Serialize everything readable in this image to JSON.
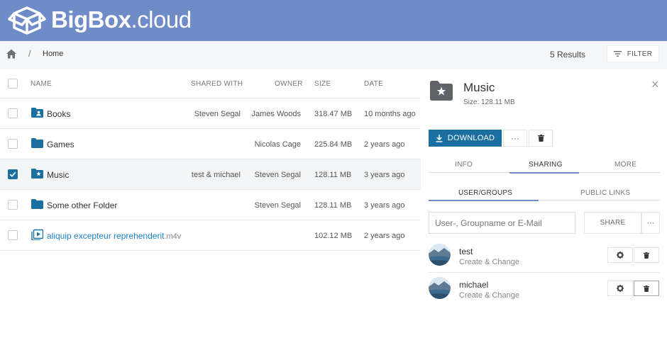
{
  "app": {
    "logo_bold": "BigBox",
    "logo_light": ".cloud"
  },
  "toolbar": {
    "breadcrumb_separator": "/",
    "breadcrumb": "Home",
    "results": "5 Results",
    "filter_label": "FILTER"
  },
  "list": {
    "columns": {
      "name": "NAME",
      "shared_with": "SHARED WITH",
      "owner": "OWNER",
      "size": "SIZE",
      "date": "DATE"
    },
    "rows": [
      {
        "name": "Books",
        "shared_with": "Steven Segal",
        "owner": "James Woods",
        "size": "318.47 MB",
        "date": "10 months ago",
        "icon": "shared-folder-icon",
        "checked": false
      },
      {
        "name": "Games",
        "shared_with": "",
        "owner": "Nicolas Cage",
        "size": "225.84 MB",
        "date": "2 years ago",
        "icon": "folder-icon",
        "checked": false
      },
      {
        "name": "Music",
        "shared_with": "test & michael",
        "owner": "Steven Segal",
        "size": "128.11 MB",
        "date": "3 years ago",
        "icon": "starred-folder-icon",
        "checked": true
      },
      {
        "name": "Some other Folder",
        "shared_with": "",
        "owner": "Steven Segal",
        "size": "128.11 MB",
        "date": "3 years ago",
        "icon": "folder-icon",
        "checked": false
      },
      {
        "name": "aliquip excepteur reprehenderit",
        "ext": ".m4v",
        "shared_with": "",
        "owner": "",
        "size": "102.12 MB",
        "date": "2 years ago",
        "icon": "video-file-icon",
        "checked": false
      }
    ]
  },
  "panel": {
    "title": "Music",
    "size": "Size: 128.11 MB",
    "download_label": "DOWNLOAD",
    "more_label": "···",
    "tabs": [
      "INFO",
      "SHARING",
      "MORE"
    ],
    "active_tab": "SHARING",
    "subtabs": [
      "USER/GROUPS",
      "PUBLIC LINKS"
    ],
    "active_subtab": "USER/GROUPS",
    "share_placeholder": "User-, Groupname or E-Mail",
    "share_label": "SHARE",
    "share_more": "···",
    "users": [
      {
        "name": "test",
        "role": "Create & Change"
      },
      {
        "name": "michael",
        "role": "Create & Change"
      }
    ]
  },
  "colors": {
    "header": "#6f8cc9",
    "primary": "#1a6fa0",
    "link": "#1b7fc4"
  }
}
